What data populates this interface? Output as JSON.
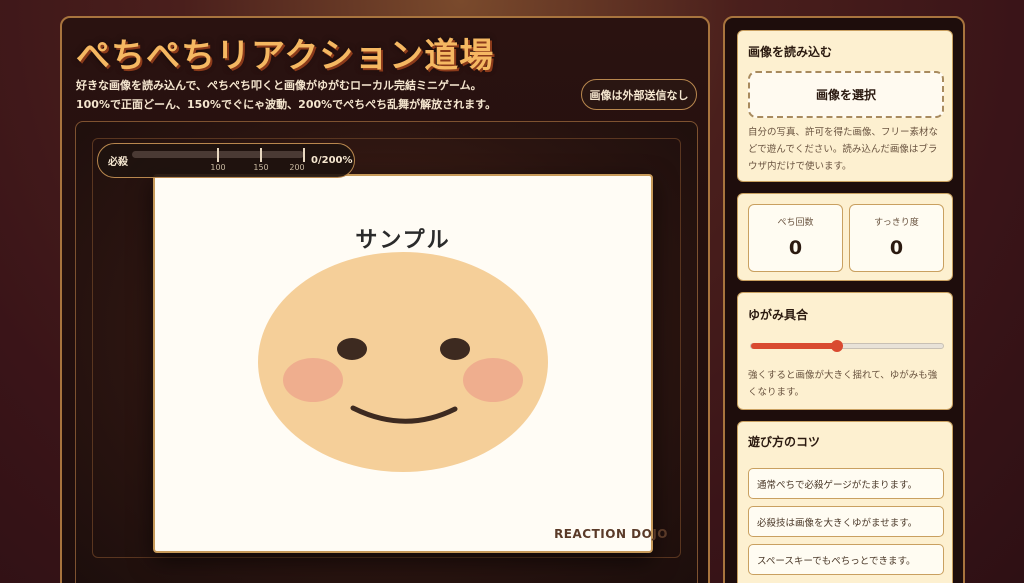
{
  "header": {
    "title": "ぺちぺちリアクション道場",
    "subtitle_line1": "好きな画像を読み込んで、ぺちぺち叩くと画像がゆがむローカル完結ミニゲーム。",
    "subtitle_line2": "100%で正面どーん、150%でぐにゃ波動、200%でぺちぺち乱舞が解放されます。",
    "privacy_badge": "画像は外部送信なし"
  },
  "stage": {
    "gauge": {
      "label": "必殺",
      "value_text": "0/200%",
      "fill_fraction": 0,
      "ticks": [
        "100",
        "150",
        "200"
      ]
    },
    "sample_label": "サンプル",
    "watermark": "REACTION DOJO",
    "colors": {
      "face": "#f5cf99",
      "blush": "#efae8e",
      "features": "#3d2a20"
    }
  },
  "sidebar": {
    "upload": {
      "title": "画像を読み込む",
      "button_label": "画像を選択",
      "note": "自分の写真、許可を得た画像、フリー素材などで遊んでください。読み込んだ画像はブラウザ内だけで使います。"
    },
    "stats": {
      "pechi_count_label": "ぺち回数",
      "pechi_count_value": "0",
      "refresh_label": "すっきり度",
      "refresh_value": "0"
    },
    "distortion": {
      "title": "ゆがみ具合",
      "level_fraction": 0.45,
      "note": "強くすると画像が大きく揺れて、ゆがみも強くなります。"
    },
    "tips": {
      "title": "遊び方のコツ",
      "items": [
        "通常ぺちで必殺ゲージがたまります。",
        "必殺技は画像を大きくゆがませます。",
        "スペースキーでもぺちっとできます。"
      ]
    }
  },
  "accent": "#f5b862"
}
